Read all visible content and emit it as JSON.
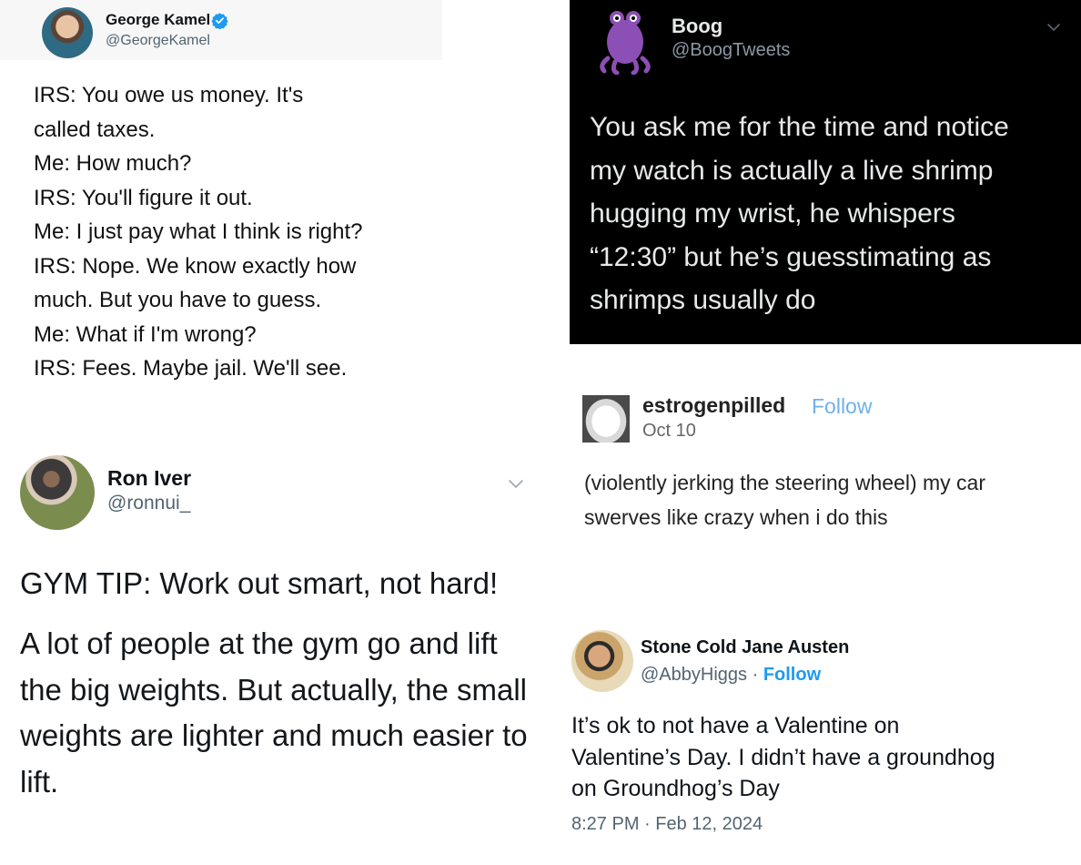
{
  "tweets": {
    "george": {
      "name": "George Kamel",
      "handle": "@GeorgeKamel",
      "lines": [
        "IRS: You owe us money. It's",
        "called taxes.",
        "Me: How much?",
        "IRS: You'll figure it out.",
        "Me: I just pay what I think is right?",
        "IRS: Nope. We know exactly how",
        "much. But you have to guess.",
        "Me: What if I'm wrong?",
        "IRS: Fees. Maybe jail. We'll see."
      ]
    },
    "boog": {
      "name": "Boog",
      "handle": "@BoogTweets",
      "lines": [
        "You ask me for the time and notice",
        "my watch is actually a live shrimp",
        "hugging my wrist, he whispers",
        "“12:30” but he’s guesstimating as",
        "shrimps usually do"
      ]
    },
    "ron": {
      "name": "Ron Iver",
      "handle": "@ronnui_",
      "tip": "GYM TIP: Work out smart, not hard!",
      "lines": [
        "A lot of people at the gym go and lift",
        "the big weights. But actually, the small",
        "weights are lighter and much easier to",
        "lift."
      ]
    },
    "estrogen": {
      "name": "estrogenpilled",
      "follow": "Follow",
      "date": "Oct 10",
      "lines": [
        "(violently jerking the steering wheel) my car",
        "swerves like crazy when i do this"
      ]
    },
    "jane": {
      "name": "Stone Cold Jane Austen",
      "handle": "@AbbyHiggs",
      "separator": " · ",
      "follow": "Follow",
      "lines": [
        "It’s ok to not have a Valentine on",
        "Valentine’s Day. I didn’t have a groundhog",
        "on Groundhog’s Day"
      ],
      "timestamp": "8:27 PM · Feb 12, 2024"
    }
  },
  "colors": {
    "verified": "#1d9bf0",
    "tumblr_follow": "#6fb0e8",
    "dark_bg": "#000000",
    "boog_avatar": "#8c4fb5"
  },
  "icons": [
    "verified-badge-icon",
    "chevron-down-icon"
  ]
}
